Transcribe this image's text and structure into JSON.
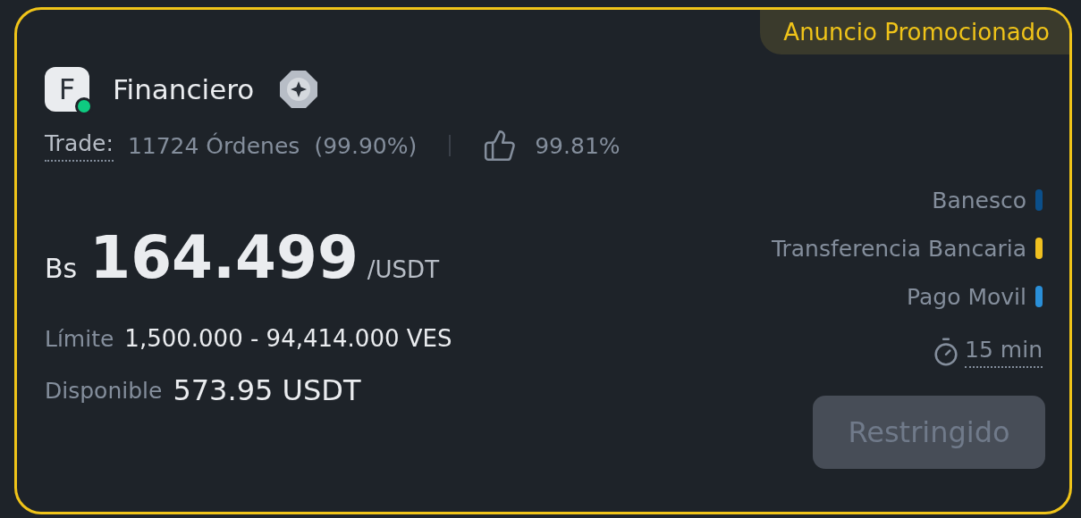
{
  "promo_tag": "Anuncio Promocionado",
  "advertiser": {
    "initial": "F",
    "name": "Financiero",
    "online": true,
    "verified": true
  },
  "stats": {
    "label": "Trade:",
    "orders": "11724 Órdenes",
    "completion": "(99.90%)",
    "rating": "99.81%"
  },
  "price": {
    "currency": "Bs",
    "amount": "164.499",
    "unit": "/USDT"
  },
  "limit": {
    "label": "Límite",
    "value": "1,500.000 - 94,414.000 VES"
  },
  "available": {
    "label": "Disponible",
    "value": "573.95 USDT"
  },
  "payment_methods": [
    {
      "name": "Banesco",
      "color": "#0b4f8a"
    },
    {
      "name": "Transferencia Bancaria",
      "color": "#f0c020"
    },
    {
      "name": "Pago Movil",
      "color": "#2a8fd8"
    }
  ],
  "time_limit": "15 min",
  "action_button": {
    "label": "Restringido",
    "disabled": true
  }
}
